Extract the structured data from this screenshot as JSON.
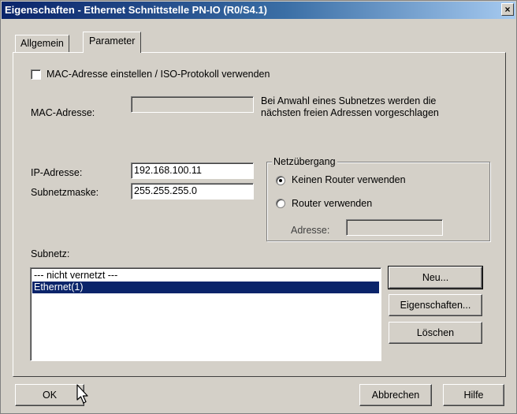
{
  "window": {
    "title": "Eigenschaften - Ethernet Schnittstelle  PN-IO (R0/S4.1)",
    "close_label": "×"
  },
  "tabs": [
    {
      "label": "Allgemein",
      "active": false
    },
    {
      "label": "Parameter",
      "active": true
    }
  ],
  "mac": {
    "checkbox_label": "MAC-Adresse einstellen / ISO-Protokoll verwenden",
    "checked": false,
    "address_label": "MAC-Adresse:",
    "address_value": "",
    "hint_line1": "Bei Anwahl eines Subnetzes werden die",
    "hint_line2": "nächsten freien Adressen vorgeschlagen"
  },
  "ip": {
    "ip_label": "IP-Adresse:",
    "ip_value": "192.168.100.11",
    "mask_label": "Subnetzmaske:",
    "mask_value": "255.255.255.0"
  },
  "gateway": {
    "legend": "Netzübergang",
    "option_no_router": "Keinen Router verwenden",
    "option_router": "Router verwenden",
    "selected": "no_router",
    "address_label": "Adresse:",
    "address_value": ""
  },
  "subnet": {
    "label": "Subnetz:",
    "items": [
      {
        "label": "--- nicht vernetzt ---",
        "selected": false
      },
      {
        "label": "Ethernet(1)",
        "selected": true
      }
    ],
    "buttons": {
      "new": "Neu...",
      "properties": "Eigenschaften...",
      "delete": "Löschen"
    }
  },
  "footer": {
    "ok": "OK",
    "cancel": "Abbrechen",
    "help": "Hilfe"
  },
  "colors": {
    "titlebar": "#0a246a",
    "selection": "#0a246a",
    "face": "#d4d0c8"
  }
}
